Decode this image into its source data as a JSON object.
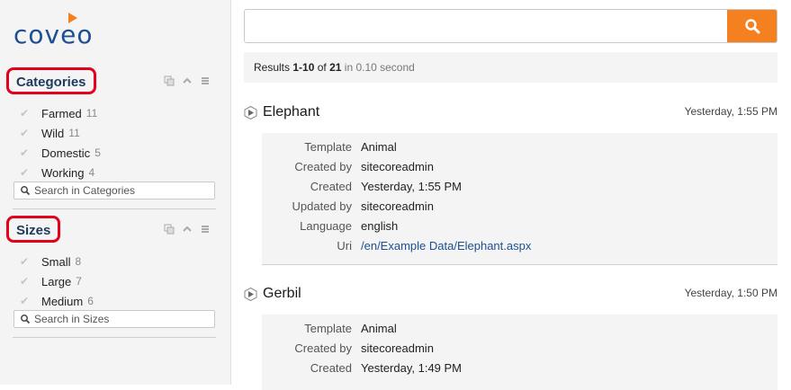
{
  "logo": {
    "text": "coveo",
    "brand_color": "#1d4f91",
    "accent_color": "#f58020"
  },
  "facets": [
    {
      "title": "Categories",
      "search_placeholder": "Search in Categories",
      "values": [
        {
          "label": "Farmed",
          "count": "11"
        },
        {
          "label": "Wild",
          "count": "11"
        },
        {
          "label": "Domestic",
          "count": "5"
        },
        {
          "label": "Working",
          "count": "4"
        }
      ]
    },
    {
      "title": "Sizes",
      "search_placeholder": "Search in Sizes",
      "values": [
        {
          "label": "Small",
          "count": "8"
        },
        {
          "label": "Large",
          "count": "7"
        },
        {
          "label": "Medium",
          "count": "6"
        }
      ]
    }
  ],
  "search": {
    "value": "",
    "button_icon": "search-icon",
    "button_color": "#f58020"
  },
  "summary": {
    "prefix": "Results ",
    "range": "1-10",
    "of": " of ",
    "total": "21",
    "duration": " in 0.10 second"
  },
  "results": [
    {
      "title": "Elephant",
      "date": "Yesterday, 1:55 PM",
      "fields": [
        {
          "key": "Template",
          "value": "Animal"
        },
        {
          "key": "Created by",
          "value": "sitecoreadmin"
        },
        {
          "key": "Created",
          "value": "Yesterday, 1:55 PM"
        },
        {
          "key": "Updated by",
          "value": "sitecoreadmin"
        },
        {
          "key": "Language",
          "value": "english"
        },
        {
          "key": "Uri",
          "value": "/en/Example Data/Elephant.aspx"
        }
      ]
    },
    {
      "title": "Gerbil",
      "date": "Yesterday, 1:50 PM",
      "fields": [
        {
          "key": "Template",
          "value": "Animal"
        },
        {
          "key": "Created by",
          "value": "sitecoreadmin"
        },
        {
          "key": "Created",
          "value": "Yesterday, 1:49 PM"
        }
      ]
    }
  ]
}
